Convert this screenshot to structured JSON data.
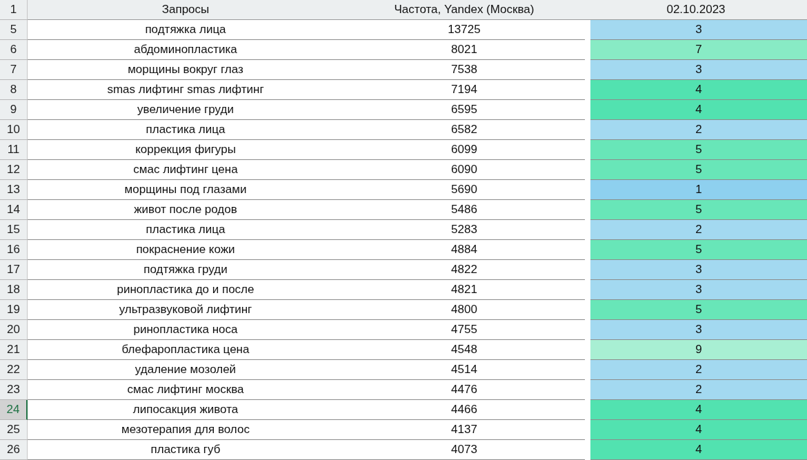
{
  "header": {
    "row_number": "1",
    "columns": [
      "Запросы",
      "Частота, Yandex (Москва)",
      "02.10.2023"
    ]
  },
  "rows": [
    {
      "row_number": "5",
      "query": "подтяжка лица",
      "frequency": "13725",
      "score": "3",
      "color": "#a3d9f0",
      "selected": false
    },
    {
      "row_number": "6",
      "query": "абдоминопластика",
      "frequency": "8021",
      "score": "7",
      "color": "#88ebc5",
      "selected": false
    },
    {
      "row_number": "7",
      "query": "морщины вокруг глаз",
      "frequency": "7538",
      "score": "3",
      "color": "#a3d9f0",
      "selected": false
    },
    {
      "row_number": "8",
      "query": "smas лифтинг smas лифтинг",
      "frequency": "7194",
      "score": "4",
      "color": "#52e2b0",
      "selected": false
    },
    {
      "row_number": "9",
      "query": "увеличение груди",
      "frequency": "6595",
      "score": "4",
      "color": "#52e2b0",
      "selected": false
    },
    {
      "row_number": "10",
      "query": "пластика лица",
      "frequency": "6582",
      "score": "2",
      "color": "#a3d9f0",
      "selected": false
    },
    {
      "row_number": "11",
      "query": "коррекция фигуры",
      "frequency": "6099",
      "score": "5",
      "color": "#68e6b8",
      "selected": false
    },
    {
      "row_number": "12",
      "query": "смас лифтинг цена",
      "frequency": "6090",
      "score": "5",
      "color": "#68e6b8",
      "selected": false
    },
    {
      "row_number": "13",
      "query": "морщины под глазами",
      "frequency": "5690",
      "score": "1",
      "color": "#8ed0ef",
      "selected": false
    },
    {
      "row_number": "14",
      "query": "живот после родов",
      "frequency": "5486",
      "score": "5",
      "color": "#68e6b8",
      "selected": false
    },
    {
      "row_number": "15",
      "query": "пластика лица",
      "frequency": "5283",
      "score": "2",
      "color": "#a3d9f0",
      "selected": false
    },
    {
      "row_number": "16",
      "query": "покраснение кожи",
      "frequency": "4884",
      "score": "5",
      "color": "#68e6b8",
      "selected": false
    },
    {
      "row_number": "17",
      "query": "подтяжка груди",
      "frequency": "4822",
      "score": "3",
      "color": "#a3d9f0",
      "selected": false
    },
    {
      "row_number": "18",
      "query": "ринопластика до и после",
      "frequency": "4821",
      "score": "3",
      "color": "#a3d9f0",
      "selected": false
    },
    {
      "row_number": "19",
      "query": "ультразвуковой лифтинг",
      "frequency": "4800",
      "score": "5",
      "color": "#68e6b8",
      "selected": false
    },
    {
      "row_number": "20",
      "query": "ринопластика носа",
      "frequency": "4755",
      "score": "3",
      "color": "#a3d9f0",
      "selected": false
    },
    {
      "row_number": "21",
      "query": "блефаропластика цена",
      "frequency": "4548",
      "score": "9",
      "color": "#a8efd3",
      "selected": false
    },
    {
      "row_number": "22",
      "query": "удаление мозолей",
      "frequency": "4514",
      "score": "2",
      "color": "#a3d9f0",
      "selected": false
    },
    {
      "row_number": "23",
      "query": "смас лифтинг москва",
      "frequency": "4476",
      "score": "2",
      "color": "#a3d9f0",
      "selected": false
    },
    {
      "row_number": "24",
      "query": "липосакция живота",
      "frequency": "4466",
      "score": "4",
      "color": "#52e2b0",
      "selected": true
    },
    {
      "row_number": "25",
      "query": "мезотерапия для волос",
      "frequency": "4137",
      "score": "4",
      "color": "#52e2b0",
      "selected": false
    },
    {
      "row_number": "26",
      "query": "пластика губ",
      "frequency": "4073",
      "score": "4",
      "color": "#52e2b0",
      "selected": false
    }
  ]
}
